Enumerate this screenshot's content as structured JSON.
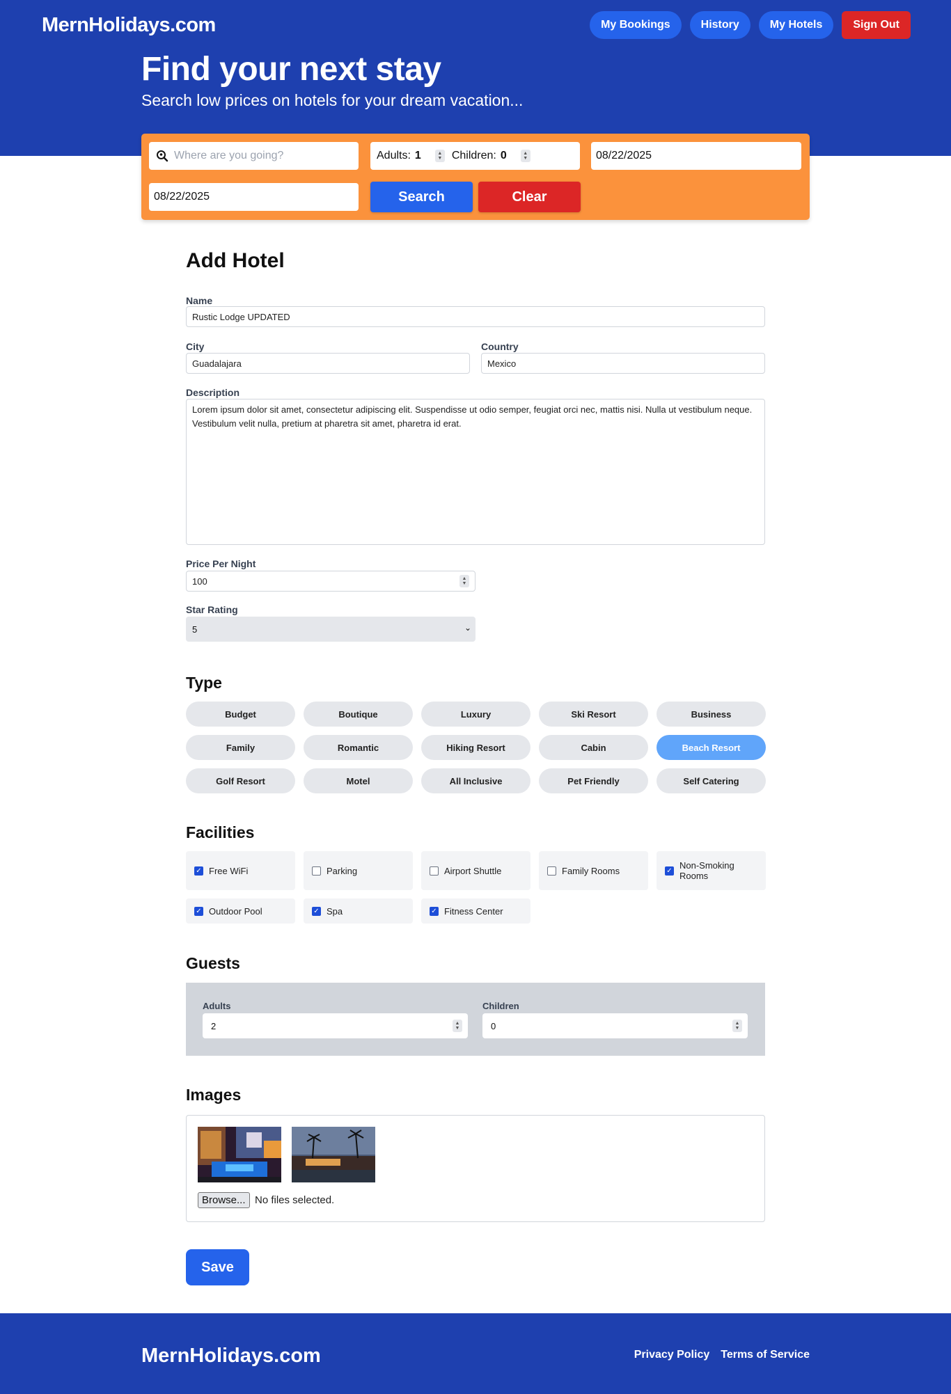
{
  "header": {
    "logo": "MernHolidays.com",
    "nav": [
      "My Bookings",
      "History",
      "My Hotels"
    ],
    "sign_out": "Sign Out"
  },
  "hero": {
    "title": "Find your next stay",
    "subtitle": "Search low prices on hotels for your dream vacation..."
  },
  "search": {
    "destination_placeholder": "Where are you going?",
    "adults_label": "Adults:",
    "adults_value": "1",
    "children_label": "Children:",
    "children_value": "0",
    "check_in": "08/22/2025",
    "check_out": "08/22/2025",
    "search_label": "Search",
    "clear_label": "Clear"
  },
  "form": {
    "title": "Add Hotel",
    "name_label": "Name",
    "name_value": "Rustic Lodge UPDATED",
    "city_label": "City",
    "city_value": "Guadalajara",
    "country_label": "Country",
    "country_value": "Mexico",
    "description_label": "Description",
    "description_value": "Lorem ipsum dolor sit amet, consectetur adipiscing elit. Suspendisse ut odio semper, feugiat orci nec, mattis nisi. Nulla ut vestibulum neque. Vestibulum velit nulla, pretium at pharetra sit amet, pharetra id erat.",
    "price_label": "Price Per Night",
    "price_value": "100",
    "star_label": "Star Rating",
    "star_value": "5",
    "save_label": "Save"
  },
  "types": {
    "heading": "Type",
    "items": [
      {
        "label": "Budget",
        "selected": false
      },
      {
        "label": "Boutique",
        "selected": false
      },
      {
        "label": "Luxury",
        "selected": false
      },
      {
        "label": "Ski Resort",
        "selected": false
      },
      {
        "label": "Business",
        "selected": false
      },
      {
        "label": "Family",
        "selected": false
      },
      {
        "label": "Romantic",
        "selected": false
      },
      {
        "label": "Hiking Resort",
        "selected": false
      },
      {
        "label": "Cabin",
        "selected": false
      },
      {
        "label": "Beach Resort",
        "selected": true
      },
      {
        "label": "Golf Resort",
        "selected": false
      },
      {
        "label": "Motel",
        "selected": false
      },
      {
        "label": "All Inclusive",
        "selected": false
      },
      {
        "label": "Pet Friendly",
        "selected": false
      },
      {
        "label": "Self Catering",
        "selected": false
      }
    ]
  },
  "facilities": {
    "heading": "Facilities",
    "items": [
      {
        "label": "Free WiFi",
        "checked": true
      },
      {
        "label": "Parking",
        "checked": false
      },
      {
        "label": "Airport Shuttle",
        "checked": false
      },
      {
        "label": "Family Rooms",
        "checked": false
      },
      {
        "label": "Non-Smoking Rooms",
        "checked": true
      },
      {
        "label": "Outdoor Pool",
        "checked": true
      },
      {
        "label": "Spa",
        "checked": true
      },
      {
        "label": "Fitness Center",
        "checked": true
      }
    ]
  },
  "guests": {
    "heading": "Guests",
    "adults_label": "Adults",
    "adults_value": "2",
    "children_label": "Children",
    "children_value": "0"
  },
  "images": {
    "heading": "Images",
    "browse_label": "Browse...",
    "status": "No files selected."
  },
  "footer": {
    "logo": "MernHolidays.com",
    "links": [
      "Privacy Policy",
      "Terms of Service"
    ]
  },
  "colors": {
    "brand_blue": "#1e40af",
    "button_blue": "#2563eb",
    "danger_red": "#dc2626",
    "search_orange": "#fb923c",
    "chip_selected": "#60a5fa"
  }
}
